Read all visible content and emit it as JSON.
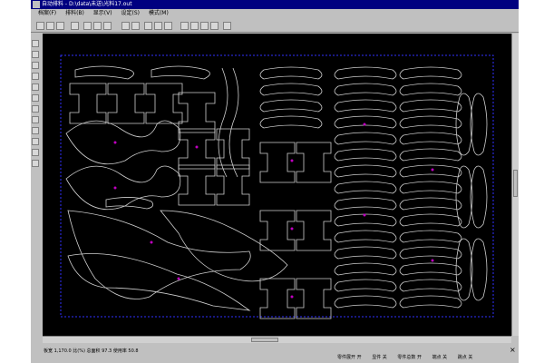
{
  "window": {
    "title": "自动排料 - D:\\data\\未送\\光料17.out"
  },
  "menu": {
    "items": [
      "档案(F)",
      "排料(B)",
      "显示(V)",
      "设定(S)",
      "模式(M)"
    ]
  },
  "status": {
    "left": "板宽 1,170.0    比(%)    总面积 97.3    使用率 50.8",
    "right": [
      "零件展开 开",
      "显件 关",
      "零件总数 开",
      "端点 关",
      "跳点 关"
    ],
    "close_label": "×"
  },
  "icons": [
    "file-new-icon",
    "open-icon",
    "save-icon",
    "print-icon",
    "zoom-in-icon",
    "zoom-out-icon",
    "rotate-icon",
    "move-icon",
    "select-icon"
  ]
}
